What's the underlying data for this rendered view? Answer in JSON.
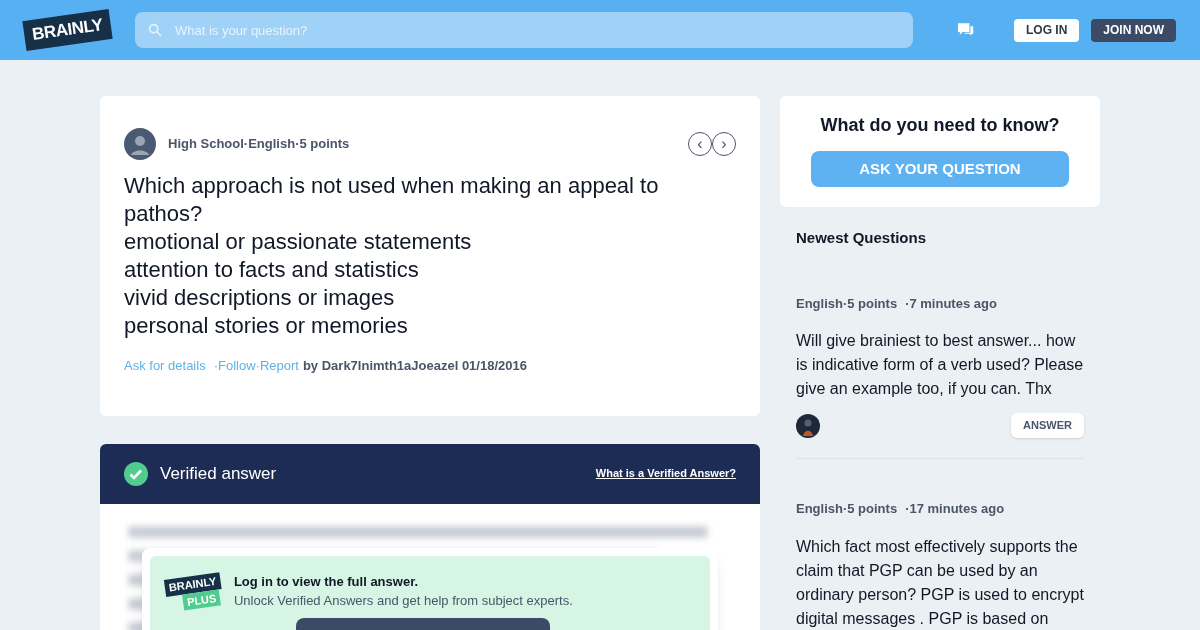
{
  "header": {
    "logo": "BRAINLY",
    "search": {
      "placeholder": "What is your question?"
    },
    "login": "LOG IN",
    "join": "JOIN NOW"
  },
  "question": {
    "meta": [
      "High School",
      "·English",
      "·5 points"
    ],
    "lines": [
      "Which approach is not used when making an appeal to pathos?",
      "emotional or passionate statements",
      "attention to facts and statistics",
      "vivid descriptions or images",
      "personal stories or memories"
    ],
    "links": [
      "Ask for details",
      "·Follow",
      "·Report"
    ],
    "author": "by Dark7lnimth1aJoeazel 01/18/2016",
    "prev": "‹",
    "next": "›"
  },
  "answer": {
    "title": "Verified answer",
    "help_link": "What is a Verified Answer?",
    "promo": {
      "logo_top": "BRAINLY",
      "logo_bottom": "PLUS",
      "title": "Log in to view the full answer.",
      "subtitle": "Unlock Verified Answers and get help from subject experts."
    }
  },
  "ask": {
    "title": "What do you need to know?",
    "button": "ASK YOUR QUESTION"
  },
  "newest": {
    "title": "Newest Questions",
    "items": [
      {
        "subject": "English",
        "points": "·5 points",
        "time": "·7 minutes ago",
        "text": "Will give brainiest to best answer... how is indicative form of a verb used? Please give an example too, if you can. Thx",
        "button": "ANSWER"
      },
      {
        "subject": "English",
        "points": "·5 points",
        "time": "·17 minutes ago",
        "text": "Which fact most effectively supports the claim that PGP can be used by an ordinary person? PGP is used to encrypt digital messages . PGP is based on"
      }
    ]
  }
}
